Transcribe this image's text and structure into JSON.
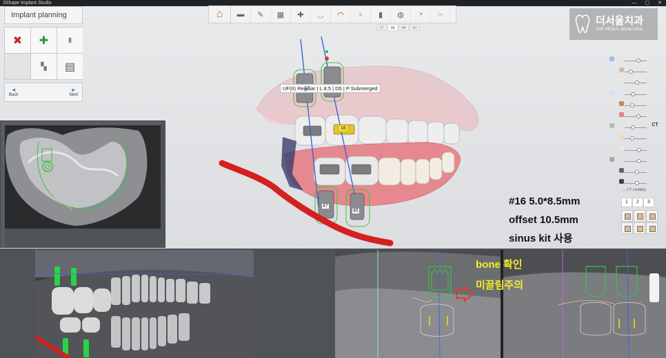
{
  "window": {
    "title": "3Shape Implant Studio",
    "controls": [
      "—",
      "▢",
      "✕"
    ]
  },
  "panel": {
    "title": "Implant planning",
    "tools": [
      {
        "name": "delete-implant-icon",
        "glyph": "✖",
        "color": "#c9282d"
      },
      {
        "name": "add-implant-icon",
        "glyph": "✚",
        "color": "#2f9a3a"
      },
      {
        "name": "implant-icon",
        "glyph": "▮",
        "color": "#888888"
      },
      {
        "name": "empty-slot",
        "glyph": "",
        "color": ""
      },
      {
        "name": "multi-implant-icon",
        "glyph": "▚",
        "color": "#777777"
      },
      {
        "name": "abutment-icon",
        "glyph": "▤",
        "color": "#555555"
      }
    ],
    "back_label": "Back",
    "next_label": "Next",
    "back_arrow": "◄",
    "next_arrow": "►"
  },
  "toolbar": {
    "home_glyph": "⌂",
    "tools": [
      "▬",
      "✎",
      "▦",
      "✚",
      "◡",
      "◠",
      "●",
      "▮",
      "◍",
      "◔",
      "✂"
    ],
    "tooth_tabs": [
      "17",
      "16",
      "46",
      "47"
    ],
    "active_tab": "16"
  },
  "logo": {
    "name": "더서울치과",
    "subtitle": "THE SEOUL Dental Clinic"
  },
  "implant_label": "UF(II) Regular | L 8.5 | D5 | P Submerged",
  "tooth_labels": {
    "t17": "17",
    "t16": "16",
    "t47": "47",
    "t46": "46"
  },
  "notes": [
    "#16 5.0*8.5mm",
    "offset 10.5mm",
    "sinus kit 사용"
  ],
  "sliders": [
    {
      "value": 0.55,
      "end": ""
    },
    {
      "value": 0.2,
      "end": ""
    },
    {
      "value": 0.5,
      "end": ""
    },
    {
      "value": 0.3,
      "end": ""
    },
    {
      "value": 0.25,
      "end": ""
    },
    {
      "value": 0.55,
      "end": ""
    },
    {
      "value": 0.3,
      "end": "CT"
    },
    {
      "value": 0.25,
      "end": ""
    },
    {
      "value": 0.6,
      "end": ""
    },
    {
      "value": 0.6,
      "end": ""
    },
    {
      "value": 0.5,
      "end": ""
    },
    {
      "value": 0.5,
      "end": ""
    }
  ],
  "ct_visibility": {
    "label": "CT visibility",
    "pages": [
      "1",
      "2",
      "3"
    ]
  },
  "bone_note": [
    "bone 확인",
    "미끌림주의"
  ],
  "colors": {
    "accent": "#2e8bd3",
    "nerve": "#d42020",
    "implant_outline": "#39c24a",
    "annotation": "#f4ee2a"
  }
}
